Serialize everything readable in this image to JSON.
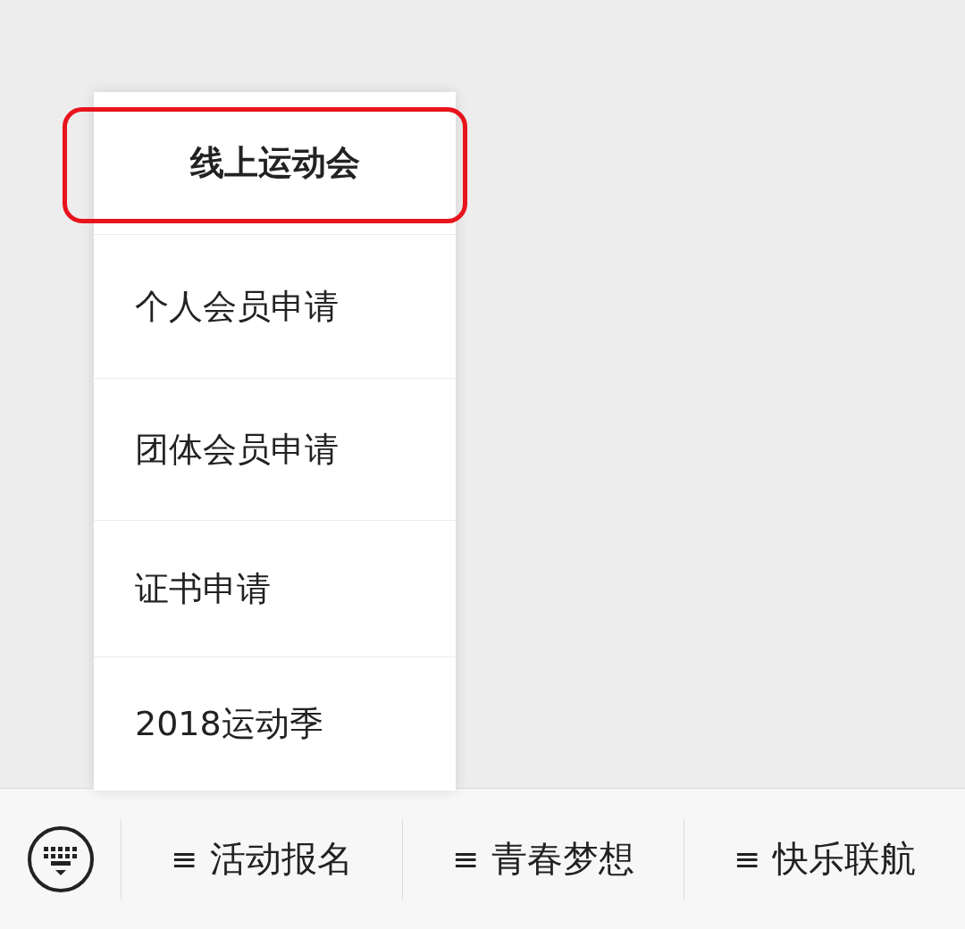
{
  "popup_menu": {
    "items": [
      {
        "label": "线上运动会",
        "highlighted": true
      },
      {
        "label": "个人会员申请",
        "highlighted": false
      },
      {
        "label": "团体会员申请",
        "highlighted": false
      },
      {
        "label": "证书申请",
        "highlighted": false
      },
      {
        "label": "2018运动季",
        "highlighted": false
      }
    ]
  },
  "bottom_menu": {
    "items": [
      {
        "prefix": "≡",
        "label": "活动报名"
      },
      {
        "prefix": "≡",
        "label": "青春梦想"
      },
      {
        "prefix": "≡",
        "label": "快乐联航"
      }
    ]
  }
}
